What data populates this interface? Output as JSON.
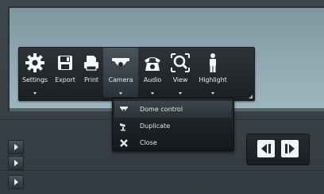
{
  "toolbar": {
    "items": [
      {
        "label": "Settings",
        "icon": "gear-icon"
      },
      {
        "label": "Export",
        "icon": "save-icon"
      },
      {
        "label": "Print",
        "icon": "printer-icon"
      },
      {
        "label": "Camera",
        "icon": "dome-camera-icon",
        "active": true
      },
      {
        "label": "Audio",
        "icon": "telephone-icon"
      },
      {
        "label": "View",
        "icon": "magnifier-icon"
      },
      {
        "label": "Highlight",
        "icon": "person-icon"
      }
    ]
  },
  "camera_menu": {
    "items": [
      {
        "label": "Dome control",
        "icon": "dome-camera-icon",
        "highlighted": true
      },
      {
        "label": "Duplicate",
        "icon": "duplicate-camera-icon"
      },
      {
        "label": "Close",
        "icon": "close-icon"
      }
    ]
  },
  "colors": {
    "toolbar_bg": "#1b1f22",
    "viewport_bg": "#8fa6b1",
    "text": "#e8ecef",
    "button_face": "#f2f4f5"
  }
}
